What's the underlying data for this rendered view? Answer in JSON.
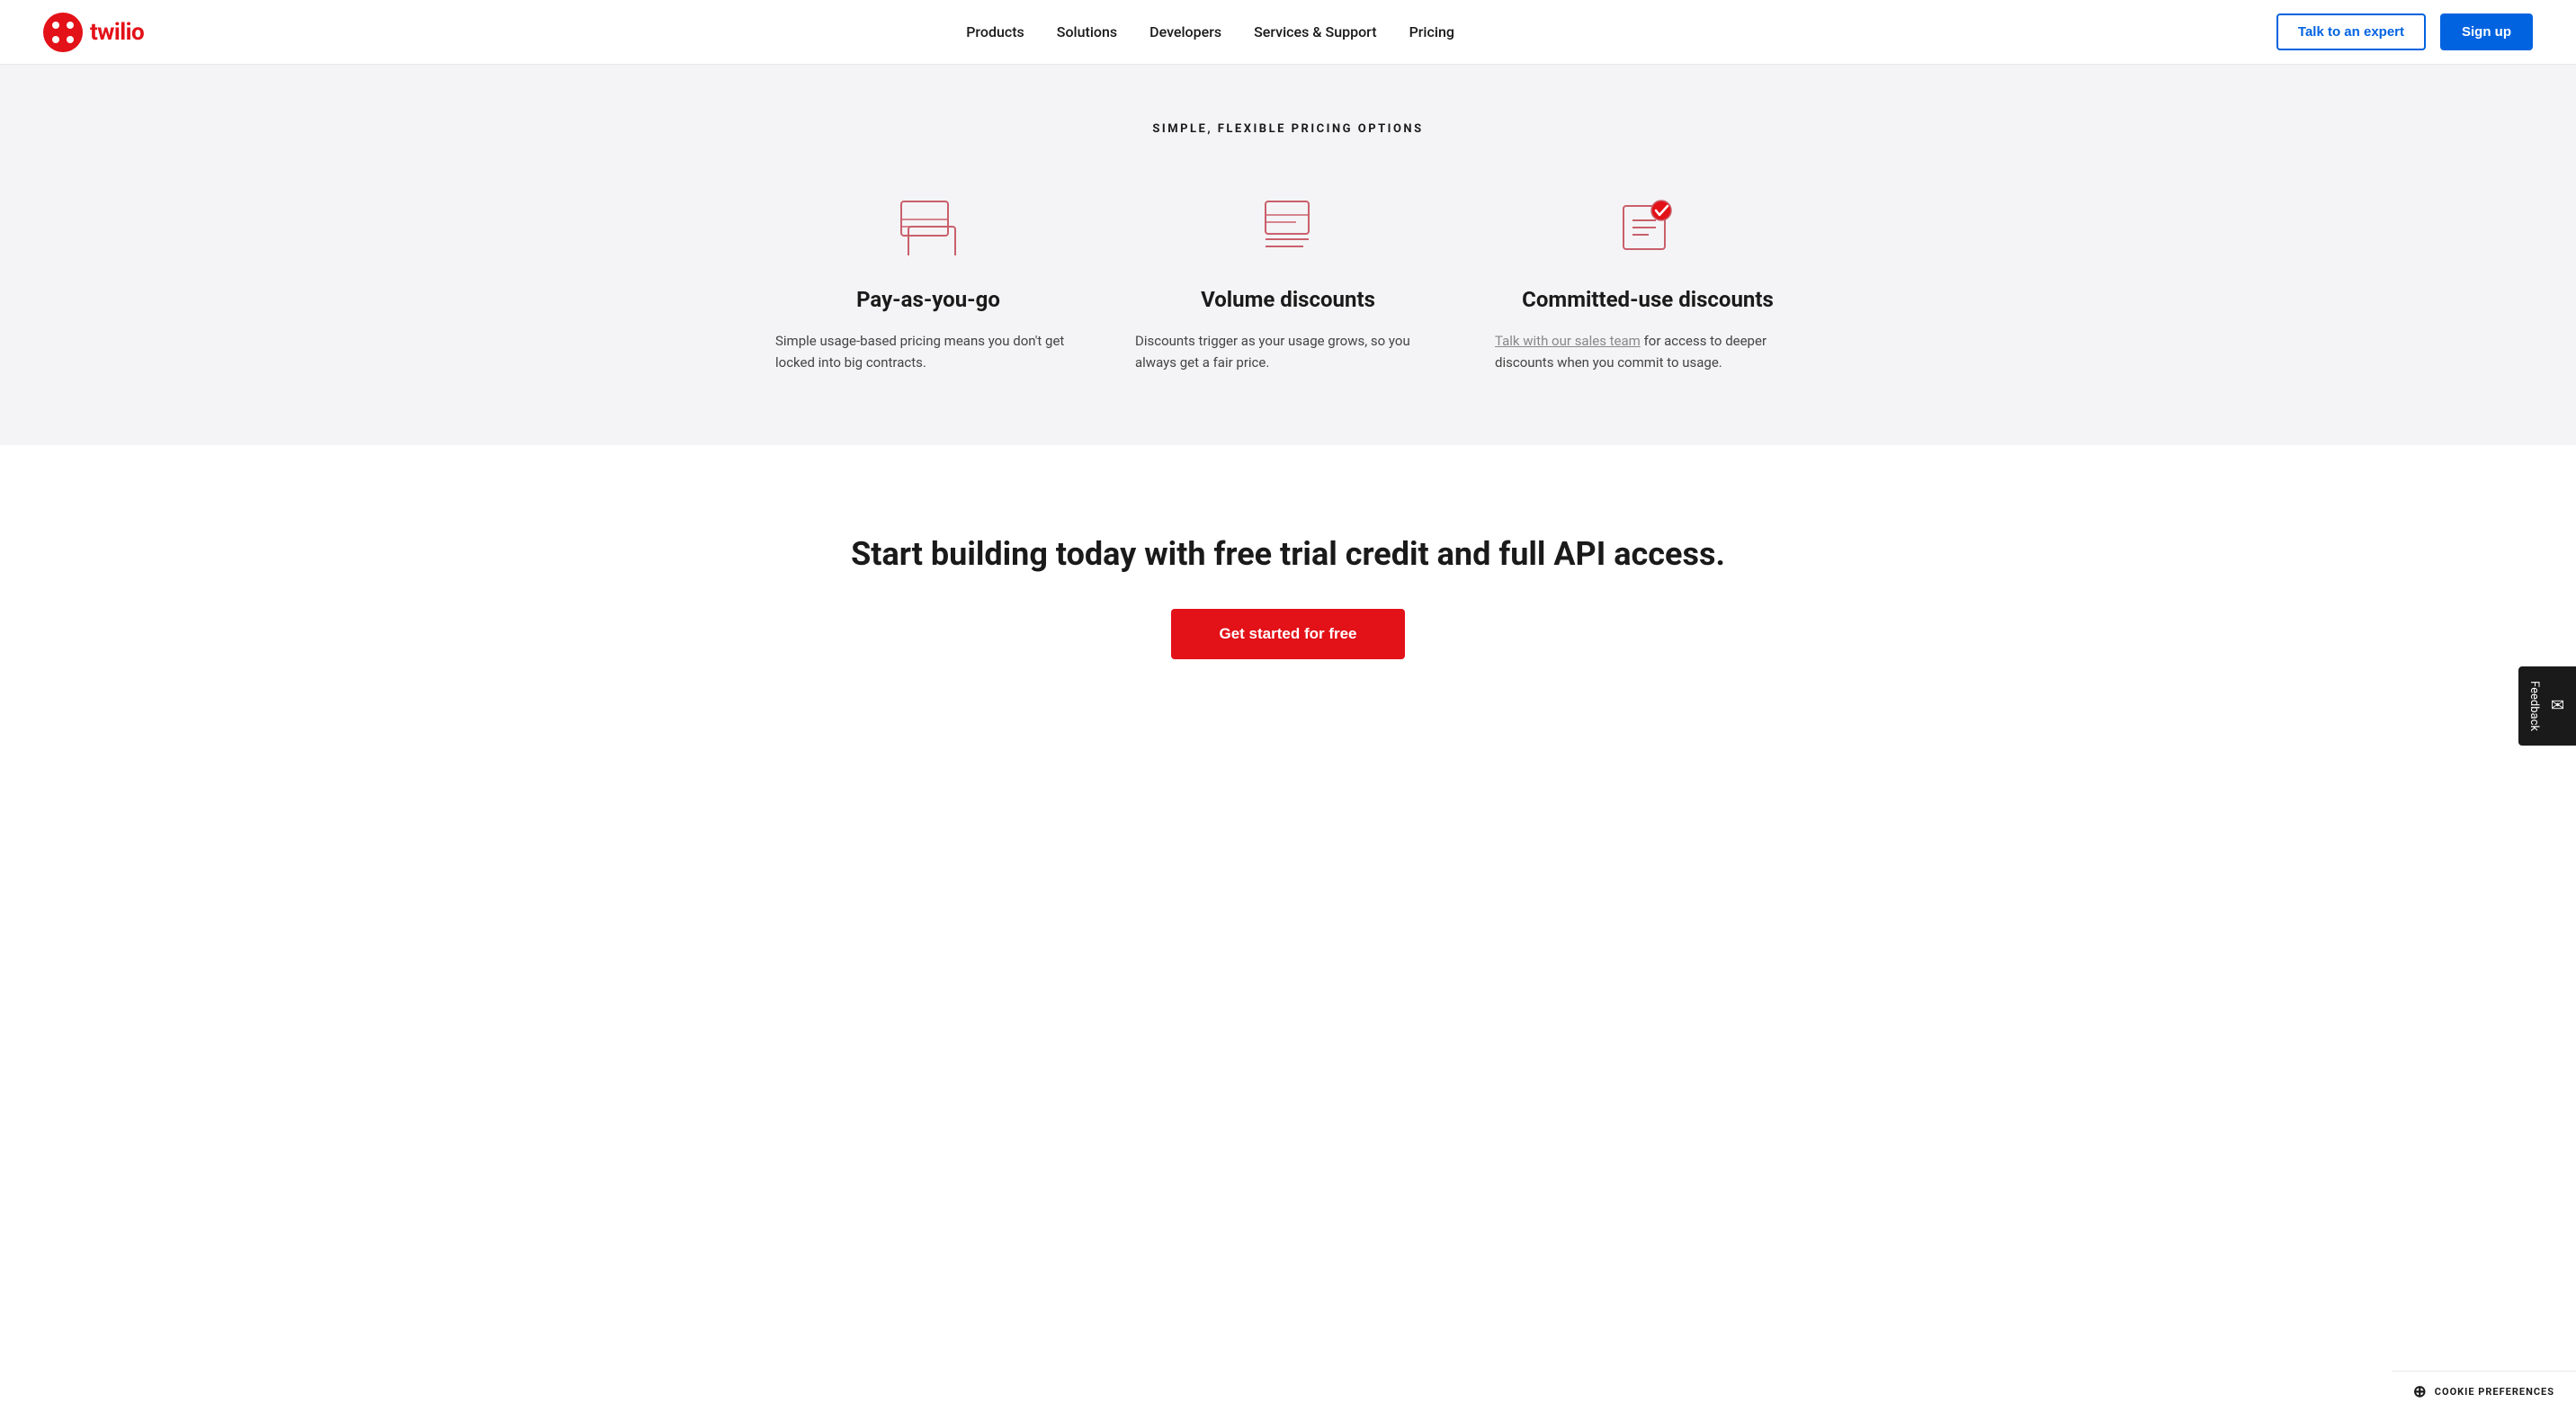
{
  "logo": {
    "text": "twilio",
    "alt": "Twilio"
  },
  "nav": {
    "links": [
      {
        "id": "products",
        "label": "Products"
      },
      {
        "id": "solutions",
        "label": "Solutions"
      },
      {
        "id": "developers",
        "label": "Developers"
      },
      {
        "id": "services-support",
        "label": "Services & Support"
      },
      {
        "id": "pricing",
        "label": "Pricing"
      }
    ],
    "talk_to_expert": "Talk to an expert",
    "sign_up": "Sign up"
  },
  "pricing_section": {
    "subtitle": "SIMPLE, FLEXIBLE PRICING OPTIONS",
    "cards": [
      {
        "id": "payg",
        "title": "Pay-as-you-go",
        "desc": "Simple usage-based pricing means you don't get locked into big contracts.",
        "link": null,
        "link_text": null
      },
      {
        "id": "volume",
        "title": "Volume discounts",
        "desc": "Discounts trigger as your usage grows, so you always get a fair price.",
        "link": null,
        "link_text": null
      },
      {
        "id": "committed",
        "title": "Committed-use discounts",
        "desc_before": "",
        "link_text": "Talk with our sales team",
        "desc_after": " for access to deeper discounts when you commit to usage."
      }
    ]
  },
  "cta_section": {
    "title": "Start building today with free trial credit and full API access.",
    "button": "Get started for free"
  },
  "feedback": {
    "label": "Feedback"
  },
  "cookie": {
    "label": "COOKIE PREFERENCES"
  }
}
